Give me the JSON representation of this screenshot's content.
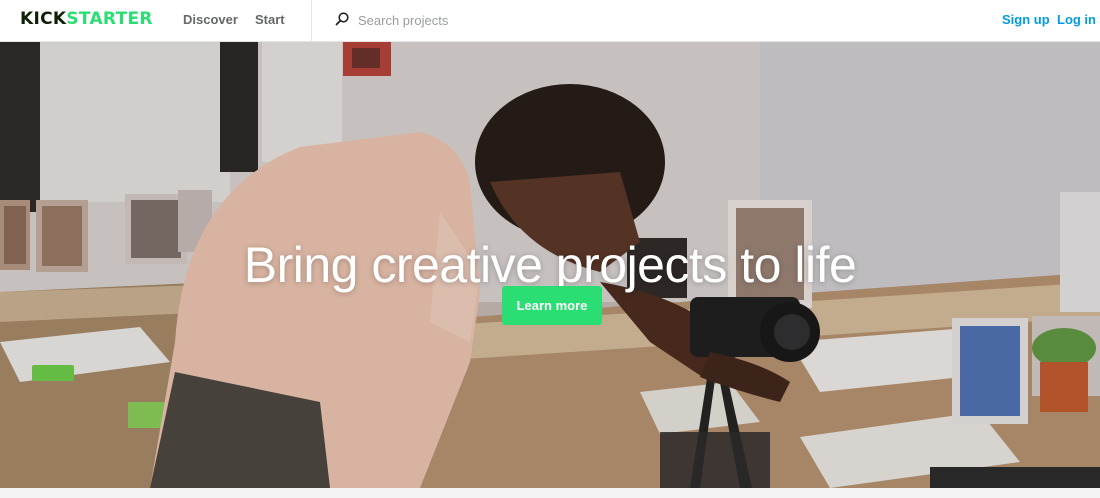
{
  "header": {
    "logo_part1": "KICK",
    "logo_part2": "STARTER",
    "nav": {
      "discover": "Discover",
      "start": "Start"
    },
    "search": {
      "placeholder": "Search projects",
      "value": ""
    },
    "auth": {
      "signup": "Sign up",
      "login": "Log in"
    }
  },
  "hero": {
    "title": "Bring creative projects to life",
    "cta_label": "Learn more"
  },
  "colors": {
    "brand_green": "#2bde73",
    "link_blue": "#009ee0",
    "nav_gray": "#656969",
    "logo_dark": "#0f2105"
  },
  "icons": [
    "search-icon"
  ]
}
